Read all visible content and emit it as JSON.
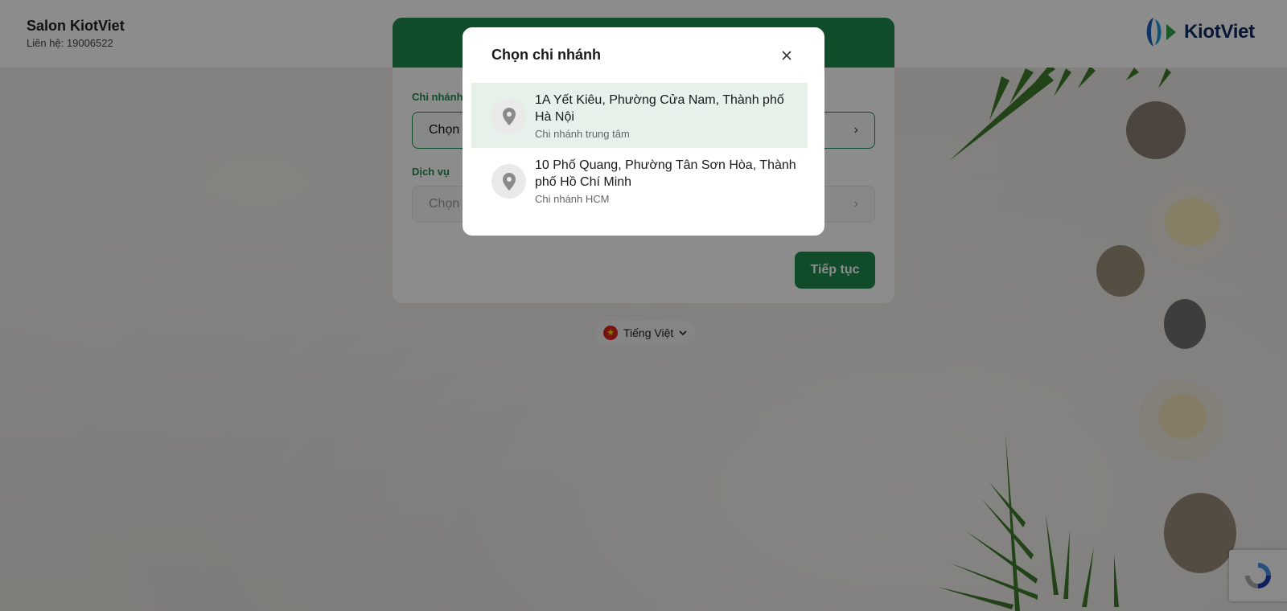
{
  "header": {
    "business_name": "Salon KiotViet",
    "contact": "Liên hệ: 19006522",
    "logo_text": "KiotViet"
  },
  "booking_form": {
    "branch_label": "Chi nhánh",
    "branch_value": "Chọn",
    "service_label": "Dịch vụ",
    "service_placeholder": "Chọn",
    "continue_label": "Tiếp tục"
  },
  "language": {
    "selected": "Tiếng Việt"
  },
  "branch_modal": {
    "title": "Chọn chi nhánh",
    "branches": [
      {
        "address": "1A Yết Kiêu, Phường Cửa Nam, Thành phố Hà Nội",
        "name": "Chi nhánh trung tâm",
        "selected": true
      },
      {
        "address": "10 Phố Quang, Phường Tân Sơn Hòa, Thành phố Hồ Chí Minh",
        "name": "Chi nhánh HCM",
        "selected": false
      }
    ]
  },
  "colors": {
    "brand_green": "#1e8a4c",
    "selected_row": "#e6f1ea",
    "logo_navy": "#0f2a5f"
  },
  "icons": [
    "close-icon",
    "location-pin-icon",
    "chevron-right-icon",
    "chevron-down-icon",
    "vietnam-flag-icon",
    "recaptcha-icon"
  ]
}
